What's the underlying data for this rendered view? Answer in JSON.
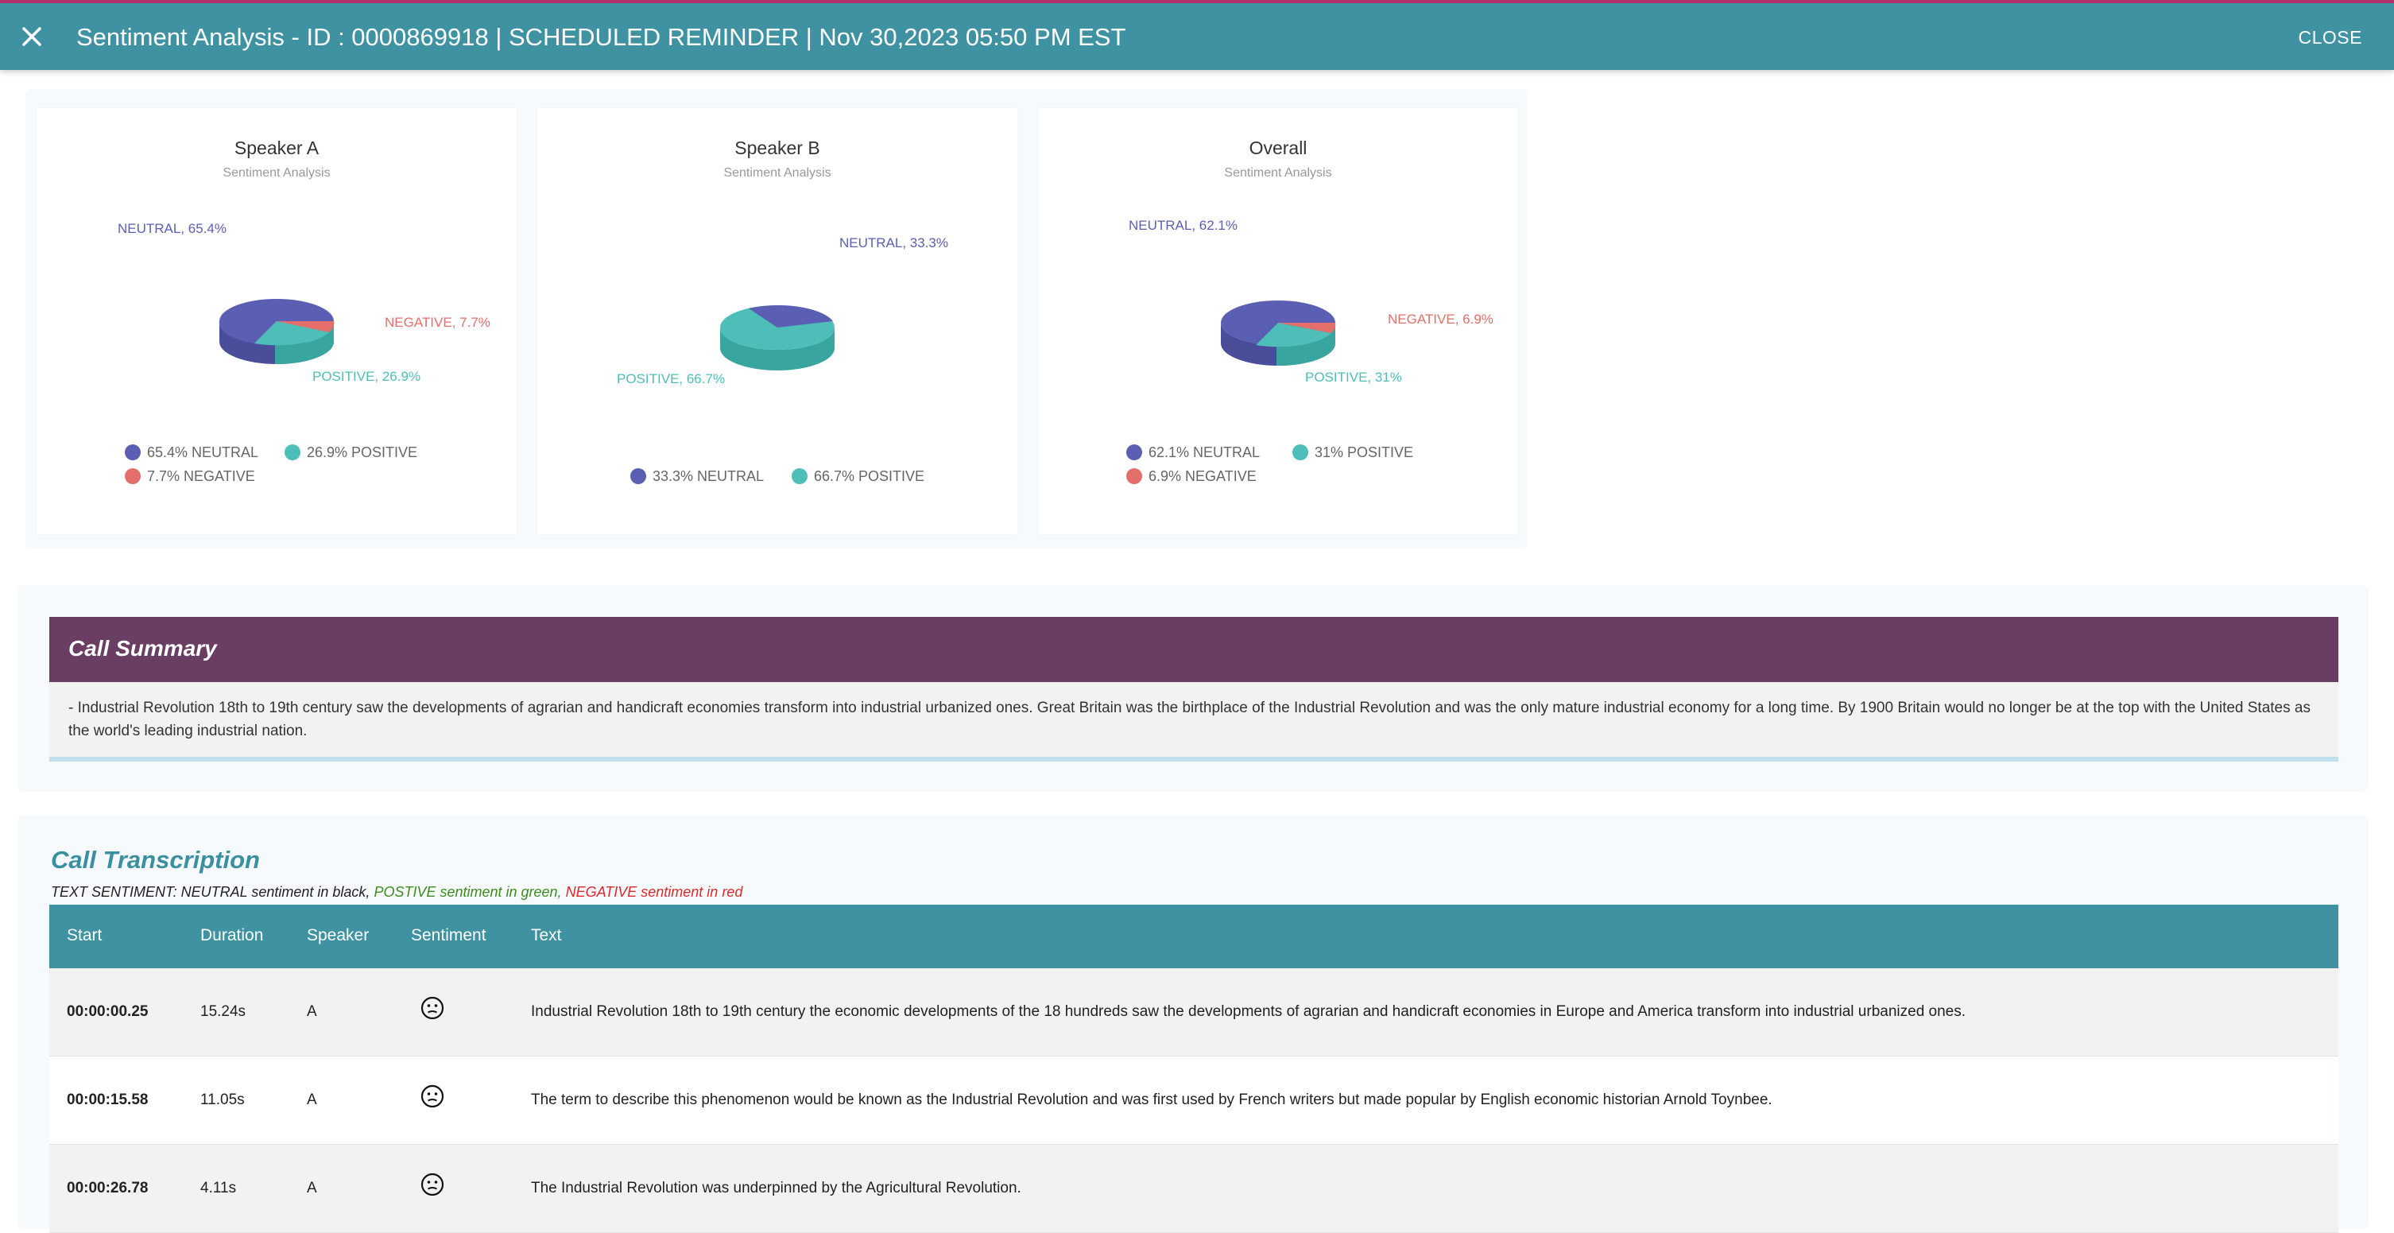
{
  "header": {
    "title": "Sentiment Analysis - ID : 0000869918 | SCHEDULED REMINDER | Nov 30,2023 05:50 PM EST",
    "close_label": "CLOSE"
  },
  "colors": {
    "neutral": "#5b5fb4",
    "positive": "#4dbfb8",
    "negative": "#e46f6a",
    "header": "#3f92a2",
    "summary_header": "#6a3d63"
  },
  "charts": [
    {
      "title": "Speaker A",
      "subtitle": "Sentiment Analysis",
      "labels": {
        "neutral": "NEUTRAL, 65.4%",
        "positive": "POSITIVE, 26.9%",
        "negative": "NEGATIVE, 7.7%"
      },
      "legend": {
        "neutral": "65.4% NEUTRAL",
        "positive": "26.9% POSITIVE",
        "negative": "7.7% NEGATIVE"
      }
    },
    {
      "title": "Speaker B",
      "subtitle": "Sentiment Analysis",
      "labels": {
        "neutral": "NEUTRAL, 33.3%",
        "positive": "POSITIVE, 66.7%"
      },
      "legend": {
        "neutral": "33.3% NEUTRAL",
        "positive": "66.7% POSITIVE"
      }
    },
    {
      "title": "Overall",
      "subtitle": "Sentiment Analysis",
      "labels": {
        "neutral": "NEUTRAL, 62.1%",
        "positive": "POSITIVE, 31%",
        "negative": "NEGATIVE, 6.9%"
      },
      "legend": {
        "neutral": "62.1% NEUTRAL",
        "positive": "31% POSITIVE",
        "negative": "6.9% NEGATIVE"
      }
    }
  ],
  "chart_data": [
    {
      "type": "pie",
      "title": "Speaker A",
      "subtitle": "Sentiment Analysis",
      "categories": [
        "NEUTRAL",
        "POSITIVE",
        "NEGATIVE"
      ],
      "values": [
        65.4,
        26.9,
        7.7
      ],
      "legend": "bottom"
    },
    {
      "type": "pie",
      "title": "Speaker B",
      "subtitle": "Sentiment Analysis",
      "categories": [
        "NEUTRAL",
        "POSITIVE"
      ],
      "values": [
        33.3,
        66.7
      ],
      "legend": "bottom"
    },
    {
      "type": "pie",
      "title": "Overall",
      "subtitle": "Sentiment Analysis",
      "categories": [
        "NEUTRAL",
        "POSITIVE",
        "NEGATIVE"
      ],
      "values": [
        62.1,
        31,
        6.9
      ],
      "legend": "bottom"
    }
  ],
  "summary": {
    "heading": "Call Summary",
    "text": "- Industrial Revolution 18th to 19th century saw the developments of agrarian and handicraft economies transform into industrial urbanized ones. Great Britain was the birthplace of the Industrial Revolution and was the only mature industrial economy for a long time. By 1900 Britain would no longer be at the top with the United States as the world's leading industrial nation."
  },
  "transcription": {
    "heading": "Call Transcription",
    "legend_prefix": "TEXT SENTIMENT: NEUTRAL sentiment in black,",
    "legend_positive": "POSTIVE sentiment in green,",
    "legend_negative": "NEGATIVE sentiment in red",
    "columns": {
      "start": "Start",
      "duration": "Duration",
      "speaker": "Speaker",
      "sentiment": "Sentiment",
      "text": "Text"
    },
    "rows": [
      {
        "start": "00:00:00.25",
        "duration": "15.24s",
        "speaker": "A",
        "sentiment": "neutral-face-icon",
        "text": "Industrial Revolution 18th to 19th century the economic developments of the 18 hundreds saw the developments of agrarian and handicraft economies in Europe and America transform into industrial urbanized ones."
      },
      {
        "start": "00:00:15.58",
        "duration": "11.05s",
        "speaker": "A",
        "sentiment": "neutral-face-icon",
        "text": "The term to describe this phenomenon would be known as the Industrial Revolution and was first used by French writers but made popular by English economic historian Arnold Toynbee."
      },
      {
        "start": "00:00:26.78",
        "duration": "4.11s",
        "speaker": "A",
        "sentiment": "neutral-face-icon",
        "text": "The Industrial Revolution was underpinned by the Agricultural Revolution."
      }
    ]
  }
}
